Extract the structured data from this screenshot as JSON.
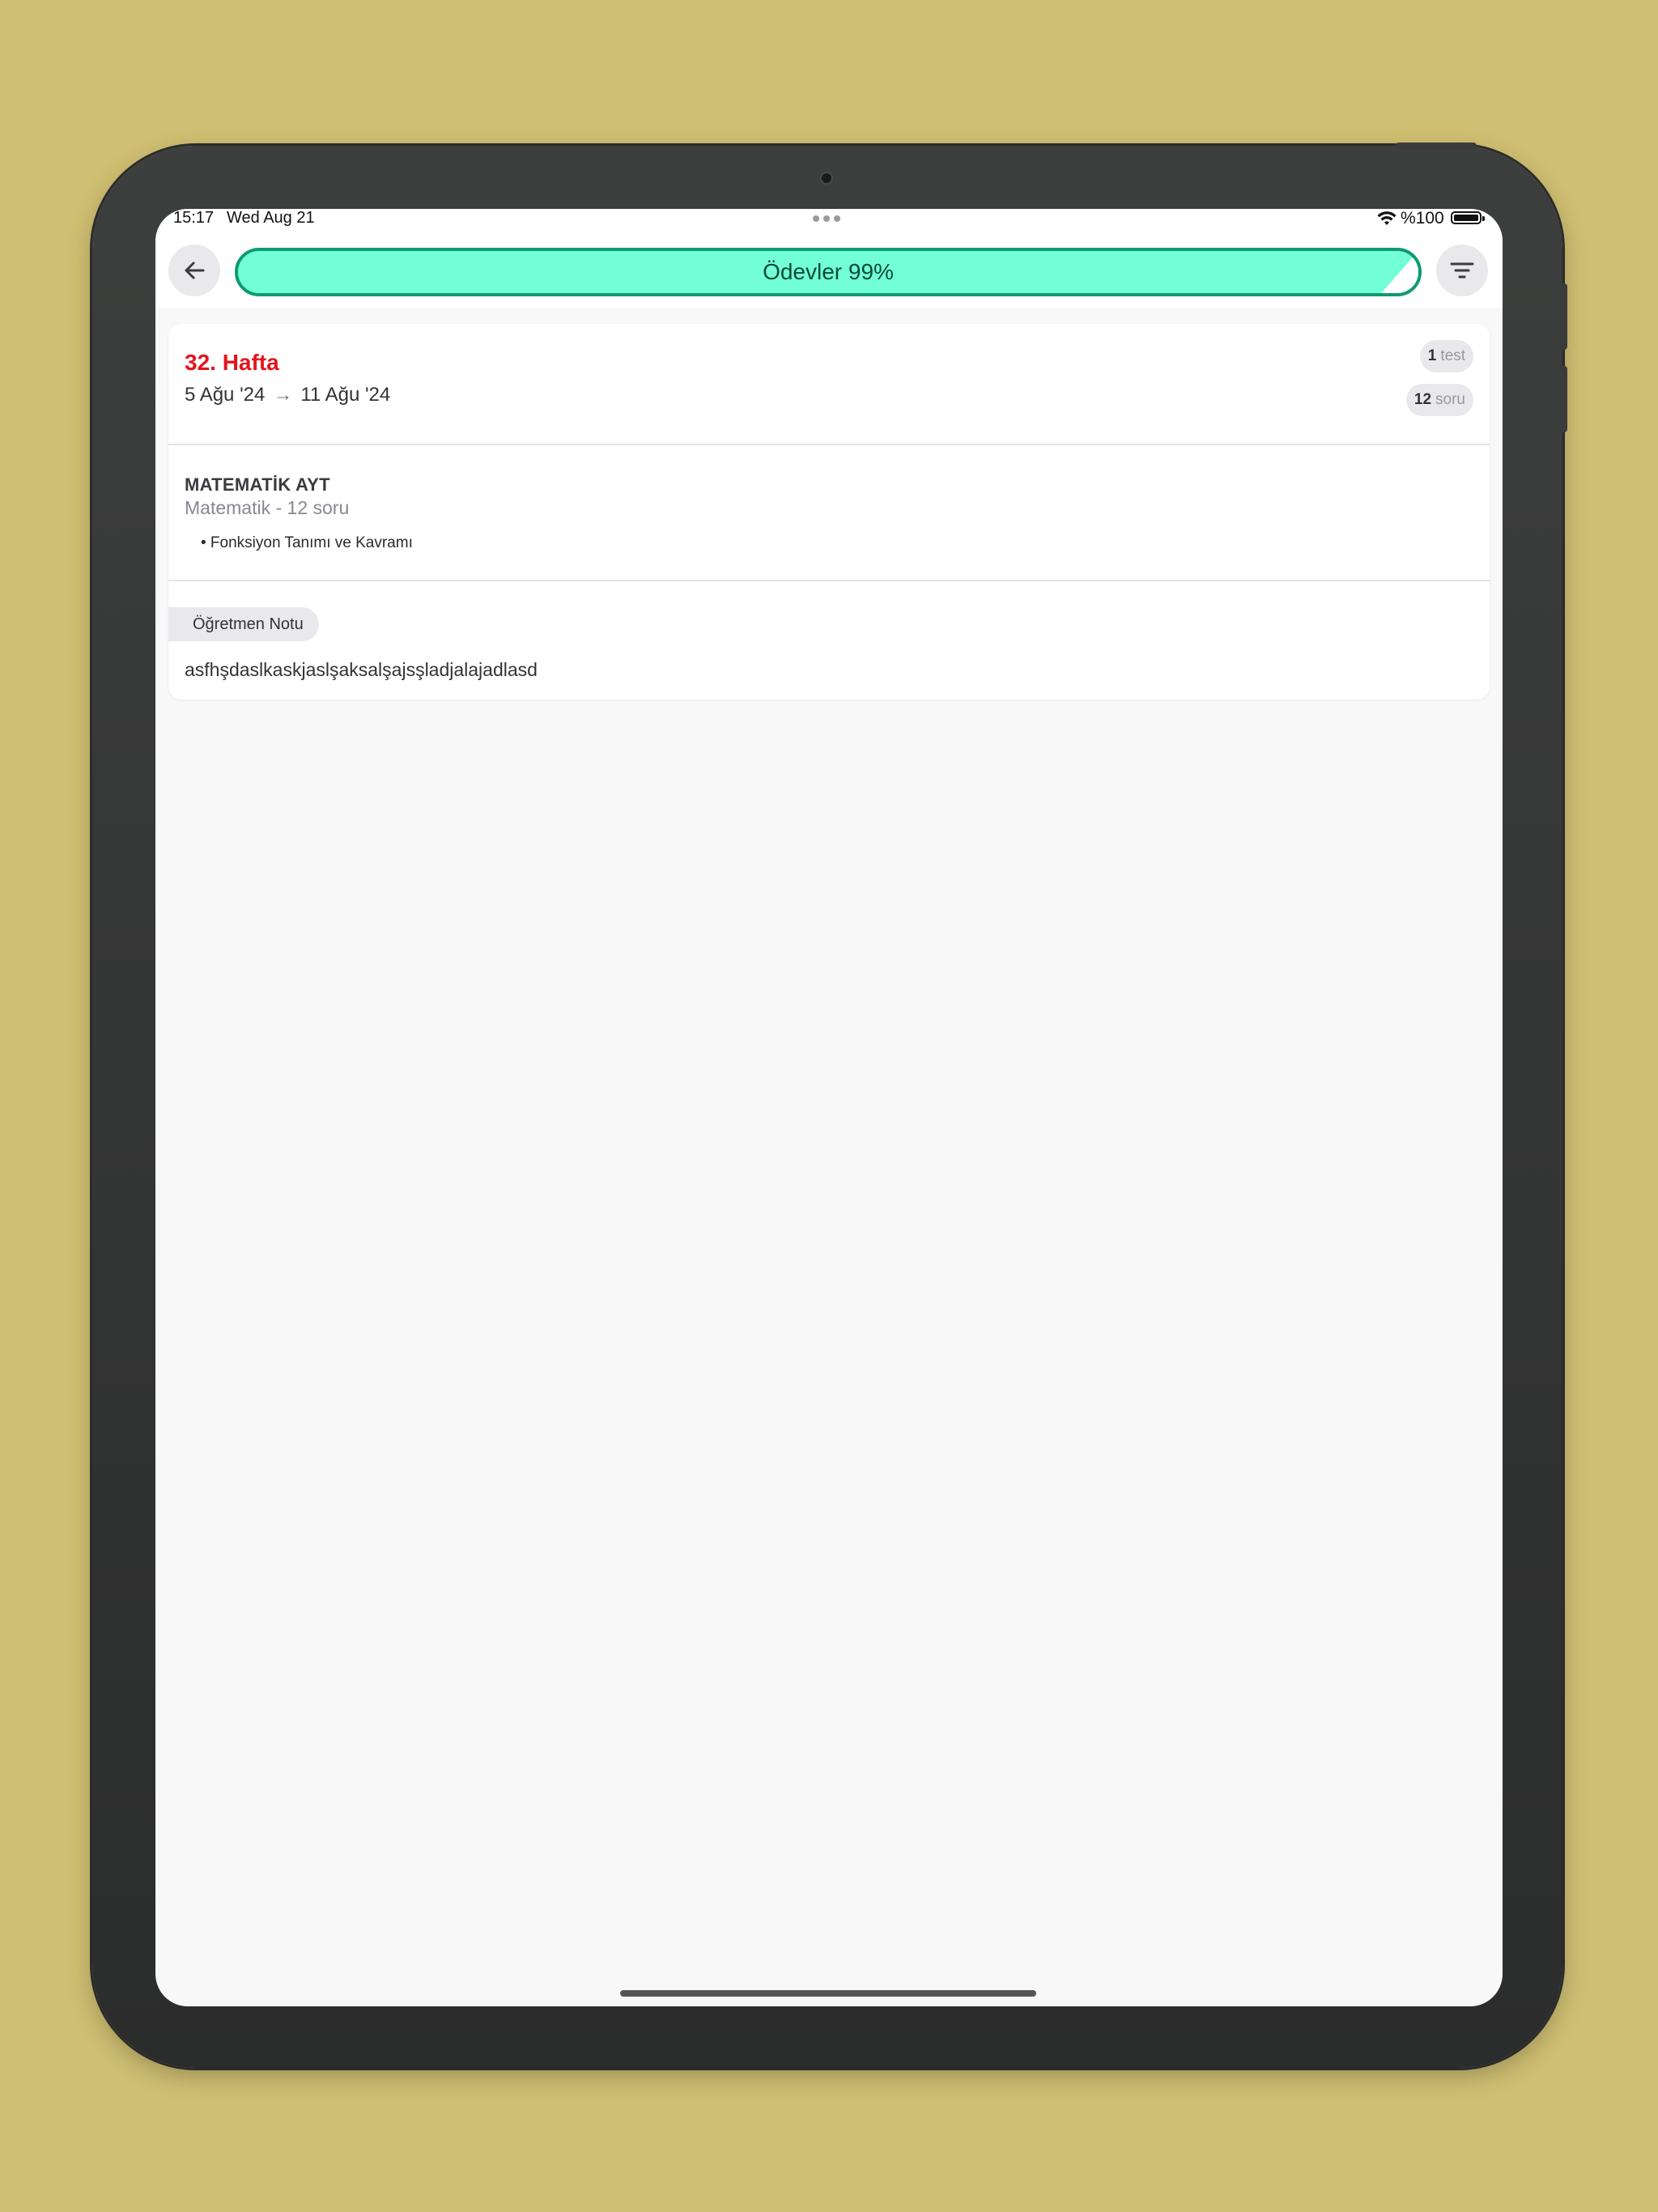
{
  "status_bar": {
    "time": "15:17",
    "date": "Wed Aug 21",
    "battery_text": "%100"
  },
  "header": {
    "title": "Ödevler 99%",
    "progress": 0.99,
    "accent_color": "#72ffd5",
    "border_color": "#0e9a72"
  },
  "week": {
    "title": "32. Hafta",
    "start": "5 Ağu '24",
    "arrow": "→",
    "end": "11 Ağu '24",
    "test_count": "1",
    "test_unit": "test",
    "question_count": "12",
    "question_unit": "soru",
    "title_color": "#e3161b"
  },
  "assignment": {
    "subject": "MATEMATİK AYT",
    "subtitle": "Matematik - 12 soru",
    "topics": [
      "• Fonksiyon Tanımı ve Kavramı"
    ]
  },
  "note": {
    "label": "Öğretmen Notu",
    "text": "asfhşdaslkaskjaslşaksalşajsşladjalajadlasd"
  },
  "icons": {
    "back": "arrow-left-icon",
    "filter": "filter-icon",
    "wifi": "wifi-icon",
    "battery": "battery-icon",
    "multitask": "multitask-dots-icon"
  }
}
